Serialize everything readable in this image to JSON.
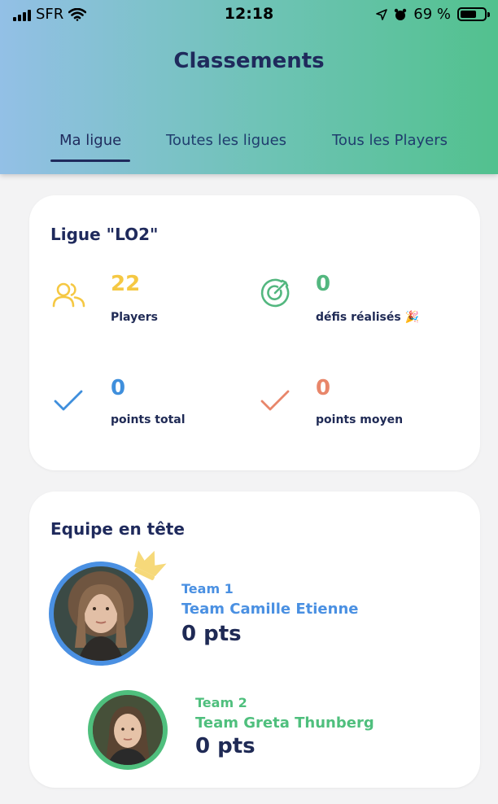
{
  "status_bar": {
    "carrier": "SFR",
    "time": "12:18",
    "battery": "69 %",
    "battery_level": 0.69
  },
  "header": {
    "title": "Classements",
    "tabs": [
      {
        "label": "Ma ligue",
        "active": true
      },
      {
        "label": "Toutes les ligues",
        "active": false
      },
      {
        "label": "Tous les Players",
        "active": false
      }
    ]
  },
  "league": {
    "title": "Ligue \"LO2\"",
    "stats": [
      {
        "value": "22",
        "label": "Players",
        "icon": "users-icon",
        "color": "#f5c843"
      },
      {
        "value": "0",
        "label": "défis réalisés 🎉",
        "icon": "target-icon",
        "color": "#53b77f"
      },
      {
        "value": "0",
        "label": "points total",
        "icon": "check-icon",
        "color": "#3f8fdc"
      },
      {
        "value": "0",
        "label": "points moyen",
        "icon": "check-icon",
        "color": "#e8866a"
      }
    ]
  },
  "leaders": {
    "title": "Equipe en tête",
    "teams": [
      {
        "label": "Team 1",
        "name": "Team Camille  Etienne",
        "points": "0 pts",
        "color": "#4a90e2",
        "icon": "crown-icon"
      },
      {
        "label": "Team 2",
        "name": "Team Greta Thunberg",
        "points": "0 pts",
        "color": "#4fbf7d"
      }
    ]
  }
}
